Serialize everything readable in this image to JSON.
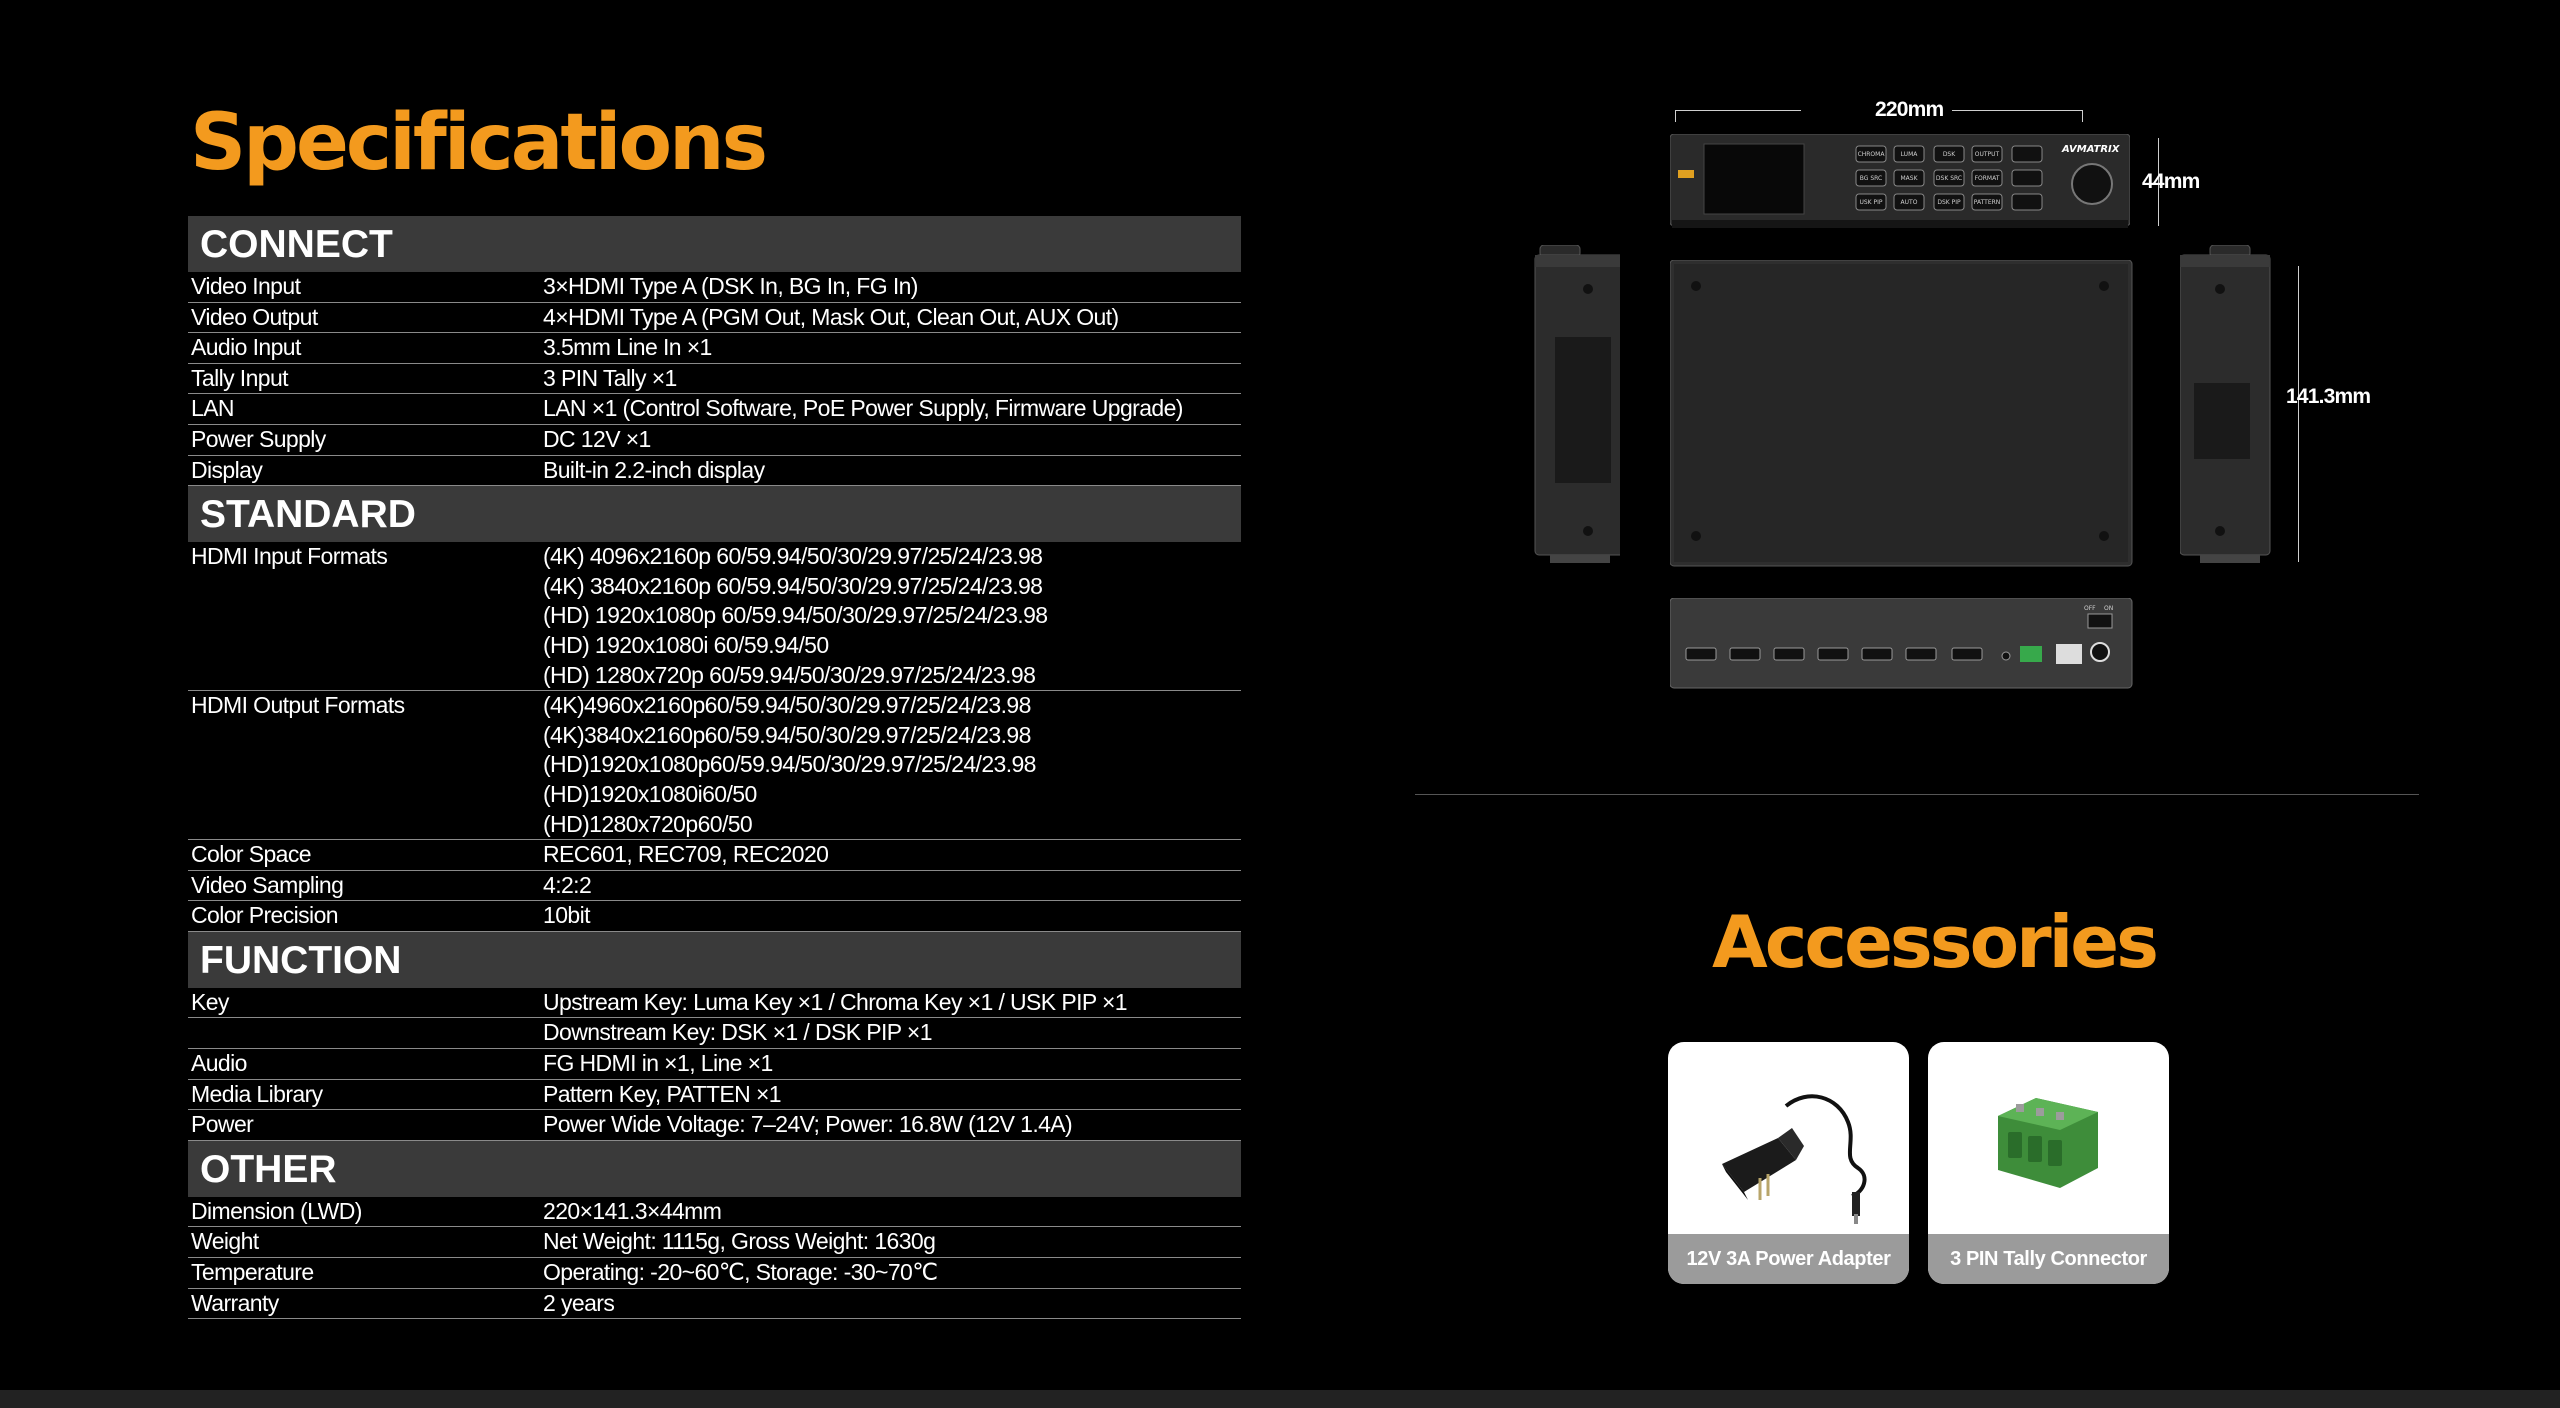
{
  "specifications": {
    "title": "Specifications",
    "sections": [
      {
        "heading": "CONNECT",
        "rows": [
          {
            "label": "Video Input",
            "values": [
              "3×HDMI Type A (DSK In, BG In, FG In)"
            ]
          },
          {
            "label": "Video Output",
            "values": [
              "4×HDMI Type A (PGM Out, Mask Out, Clean Out, AUX Out)"
            ]
          },
          {
            "label": "Audio Input",
            "values": [
              "3.5mm Line In ×1"
            ]
          },
          {
            "label": "Tally Input",
            "values": [
              "3 PIN Tally ×1"
            ]
          },
          {
            "label": "LAN",
            "values": [
              "LAN ×1 (Control Software, PoE Power Supply, Firmware Upgrade)"
            ]
          },
          {
            "label": "Power Supply",
            "values": [
              "DC 12V ×1"
            ]
          },
          {
            "label": "Display",
            "values": [
              "Built-in 2.2-inch display"
            ]
          }
        ]
      },
      {
        "heading": "STANDARD",
        "rows": [
          {
            "label": "HDMI Input Formats",
            "values": [
              "(4K) 4096x2160p 60/59.94/50/30/29.97/25/24/23.98",
              "(4K) 3840x2160p 60/59.94/50/30/29.97/25/24/23.98",
              "(HD) 1920x1080p 60/59.94/50/30/29.97/25/24/23.98",
              "(HD) 1920x1080i 60/59.94/50",
              "(HD) 1280x720p 60/59.94/50/30/29.97/25/24/23.98"
            ]
          },
          {
            "label": "HDMI Output Formats",
            "values": [
              "(4K)4960x2160p60/59.94/50/30/29.97/25/24/23.98",
              "(4K)3840x2160p60/59.94/50/30/29.97/25/24/23.98",
              "(HD)1920x1080p60/59.94/50/30/29.97/25/24/23.98",
              "(HD)1920x1080i60/50",
              "(HD)1280x720p60/50"
            ]
          },
          {
            "label": "Color Space",
            "values": [
              "REC601, REC709, REC2020"
            ]
          },
          {
            "label": "Video Sampling",
            "values": [
              "4:2:2"
            ]
          },
          {
            "label": "Color Precision",
            "values": [
              "10bit"
            ]
          }
        ]
      },
      {
        "heading": "FUNCTION",
        "rows": [
          {
            "label": "Key",
            "values": [
              "Upstream Key: Luma Key ×1 / Chroma Key ×1 / USK PIP ×1"
            ]
          },
          {
            "label": "",
            "values": [
              "Downstream Key: DSK ×1 / DSK PIP ×1"
            ]
          },
          {
            "label": "Audio",
            "values": [
              "FG HDMI in ×1, Line ×1"
            ]
          },
          {
            "label": "Media Library",
            "values": [
              "Pattern Key, PATTEN ×1"
            ]
          },
          {
            "label": "Power",
            "values": [
              "Power Wide Voltage: 7–24V; Power: 16.8W (12V 1.4A)"
            ]
          }
        ]
      },
      {
        "heading": "OTHER",
        "rows": [
          {
            "label": "Dimension (LWD)",
            "values": [
              "220×141.3×44mm"
            ]
          },
          {
            "label": "Weight",
            "values": [
              "Net Weight: 1115g, Gross Weight: 1630g"
            ]
          },
          {
            "label": "Temperature",
            "values": [
              "Operating: -20~60℃, Storage: -30~70℃"
            ]
          },
          {
            "label": "Warranty",
            "values": [
              "2 years"
            ]
          }
        ]
      }
    ]
  },
  "diagram": {
    "width_label": "220mm",
    "height_label": "44mm",
    "depth_label": "141.3mm",
    "brand_logo": "AVMATRIX",
    "front_buttons": [
      "CHROMA",
      "LUMA",
      "DSK",
      "OUTPUT",
      "BG SRC",
      "MASK",
      "DSK SRC",
      "FORMAT",
      "USK PIP",
      "AUTO",
      "DSK PIP",
      "PATTERN"
    ],
    "rear_switch_labels": [
      "OFF",
      "ON"
    ]
  },
  "accessories": {
    "title": "Accessories",
    "items": [
      {
        "caption": "12V 3A Power Adapter",
        "icon": "power-adapter-icon"
      },
      {
        "caption": "3 PIN Tally Connector",
        "icon": "tally-connector-icon"
      }
    ]
  },
  "colors": {
    "accent": "#f39a1e",
    "background": "#000000",
    "section_header": "#3a3a3a",
    "caption_bg": "#9b9b9b"
  }
}
